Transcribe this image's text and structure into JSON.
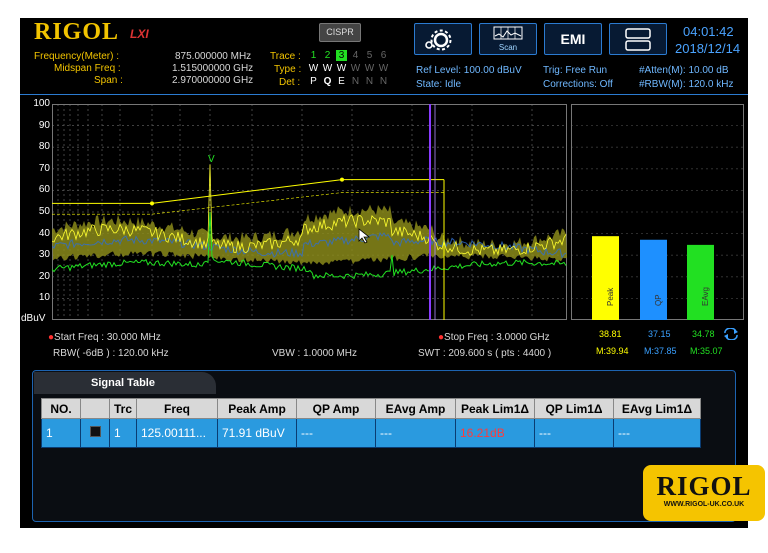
{
  "brand": {
    "logo": "RIGOL",
    "badge": "LXI"
  },
  "header": {
    "freq_meter_label": "Frequency(Meter) :",
    "freq_meter_value": "875.000000 MHz",
    "midspan_label": "Midspan Freq :",
    "midspan_value": "1.515000000 GHz",
    "span_label": "Span :",
    "span_value": "2.970000000 GHz",
    "trace_label": "Trace :",
    "type_label": "Type :",
    "det_label": "Det :",
    "trace_nums": [
      "1",
      "2",
      "3",
      "4",
      "5",
      "6"
    ],
    "types": [
      "W",
      "W",
      "W",
      "W",
      "W",
      "W"
    ],
    "dets": [
      "P",
      "Q",
      "E",
      "N",
      "N",
      "N"
    ],
    "cispr": "CISPR",
    "scan_label": "Scan",
    "emi_label": "EMI",
    "time": "04:01:42",
    "date": "2018/12/14",
    "ref_level": "Ref Level: 100.00 dBuV",
    "state": "State: Idle",
    "trig": "Trig: Free Run",
    "corrections": "Corrections: Off",
    "atten": "#Atten(M): 10.00 dB",
    "rbw": "#RBW(M): 120.0 kHz"
  },
  "plot": {
    "y_labels": [
      "100",
      "90",
      "80",
      "70",
      "60",
      "50",
      "40",
      "30",
      "20",
      "10"
    ],
    "unit": "dBuV",
    "marker_label": "V",
    "start_freq": "Start Freq : 30.000 MHz",
    "stop_freq": "Stop Freq : 3.0000 GHz",
    "rbw_info": "RBW( -6dB ) : 120.00 kHz",
    "vbw_info": "VBW : 1.0000 MHz",
    "swt_info": "SWT : 209.600 s ( pts : 4400 )"
  },
  "bars": {
    "items": [
      {
        "name": "Peak",
        "value": 38.81,
        "value_text": "38.81",
        "max_text": "M:39.94",
        "color": "#ffff00"
      },
      {
        "name": "QP",
        "value": 37.15,
        "value_text": "37.15",
        "max_text": "M:37.85",
        "color": "#1e90ff"
      },
      {
        "name": "EAvg",
        "value": 34.78,
        "value_text": "34.78",
        "max_text": "M:35.07",
        "color": "#22e022"
      }
    ]
  },
  "signal_table": {
    "tab_label": "Signal Table",
    "columns": [
      "NO.",
      "",
      "Trc",
      "Freq",
      "Peak Amp",
      "QP Amp",
      "EAvg Amp",
      "Peak Lim1Δ",
      "QP Lim1Δ",
      "EAvg Lim1Δ"
    ],
    "row": {
      "no": "1",
      "trc": "1",
      "freq": "125.00111...",
      "peak_amp": "71.91 dBuV",
      "qp_amp": "---",
      "eavg_amp": "---",
      "peak_lim": "16.21dB",
      "qp_lim": "---",
      "eavg_lim": "---"
    }
  },
  "watermark": {
    "logo": "RIGOL",
    "url": "WWW.RIGOL-UK.CO.UK"
  },
  "colors": {
    "accent": "#2b7bd1",
    "yellow": "#ffff00",
    "green": "#22e022",
    "limit_red": "#ff3b3b"
  }
}
